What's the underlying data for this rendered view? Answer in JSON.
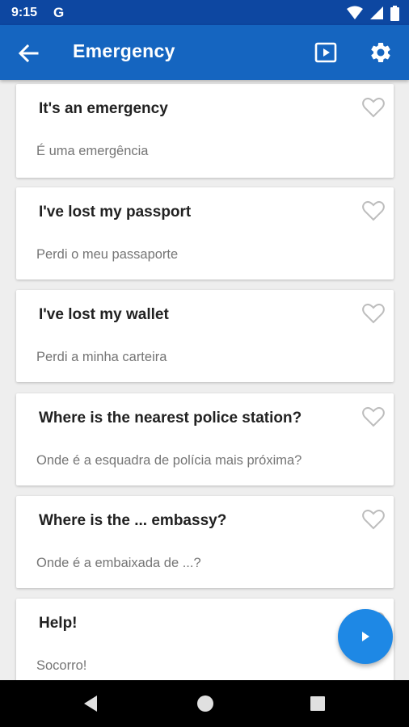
{
  "status_bar": {
    "time": "9:15",
    "g_label": "G"
  },
  "app_bar": {
    "title": "Emergency",
    "back_icon": "arrow-left-icon",
    "play_icon": "play-box-icon",
    "settings_icon": "gear-icon"
  },
  "phrases": [
    {
      "phrase": "It's an emergency",
      "translation": "É uma emergência"
    },
    {
      "phrase": "I've lost my passport",
      "translation": "Perdi o meu passaporte"
    },
    {
      "phrase": "I've lost my wallet",
      "translation": "Perdi a minha carteira"
    },
    {
      "phrase": "Where is the nearest police station?",
      "translation": "Onde é a esquadra de polícia mais próxima?"
    },
    {
      "phrase": "Where is the ... embassy?",
      "translation": "Onde é a embaixada de ...?"
    },
    {
      "phrase": "Help!",
      "translation": "Socorro!"
    }
  ],
  "colors": {
    "status_bar": "#0d47a1",
    "app_bar": "#1565c0",
    "fab": "#1e88e5"
  }
}
